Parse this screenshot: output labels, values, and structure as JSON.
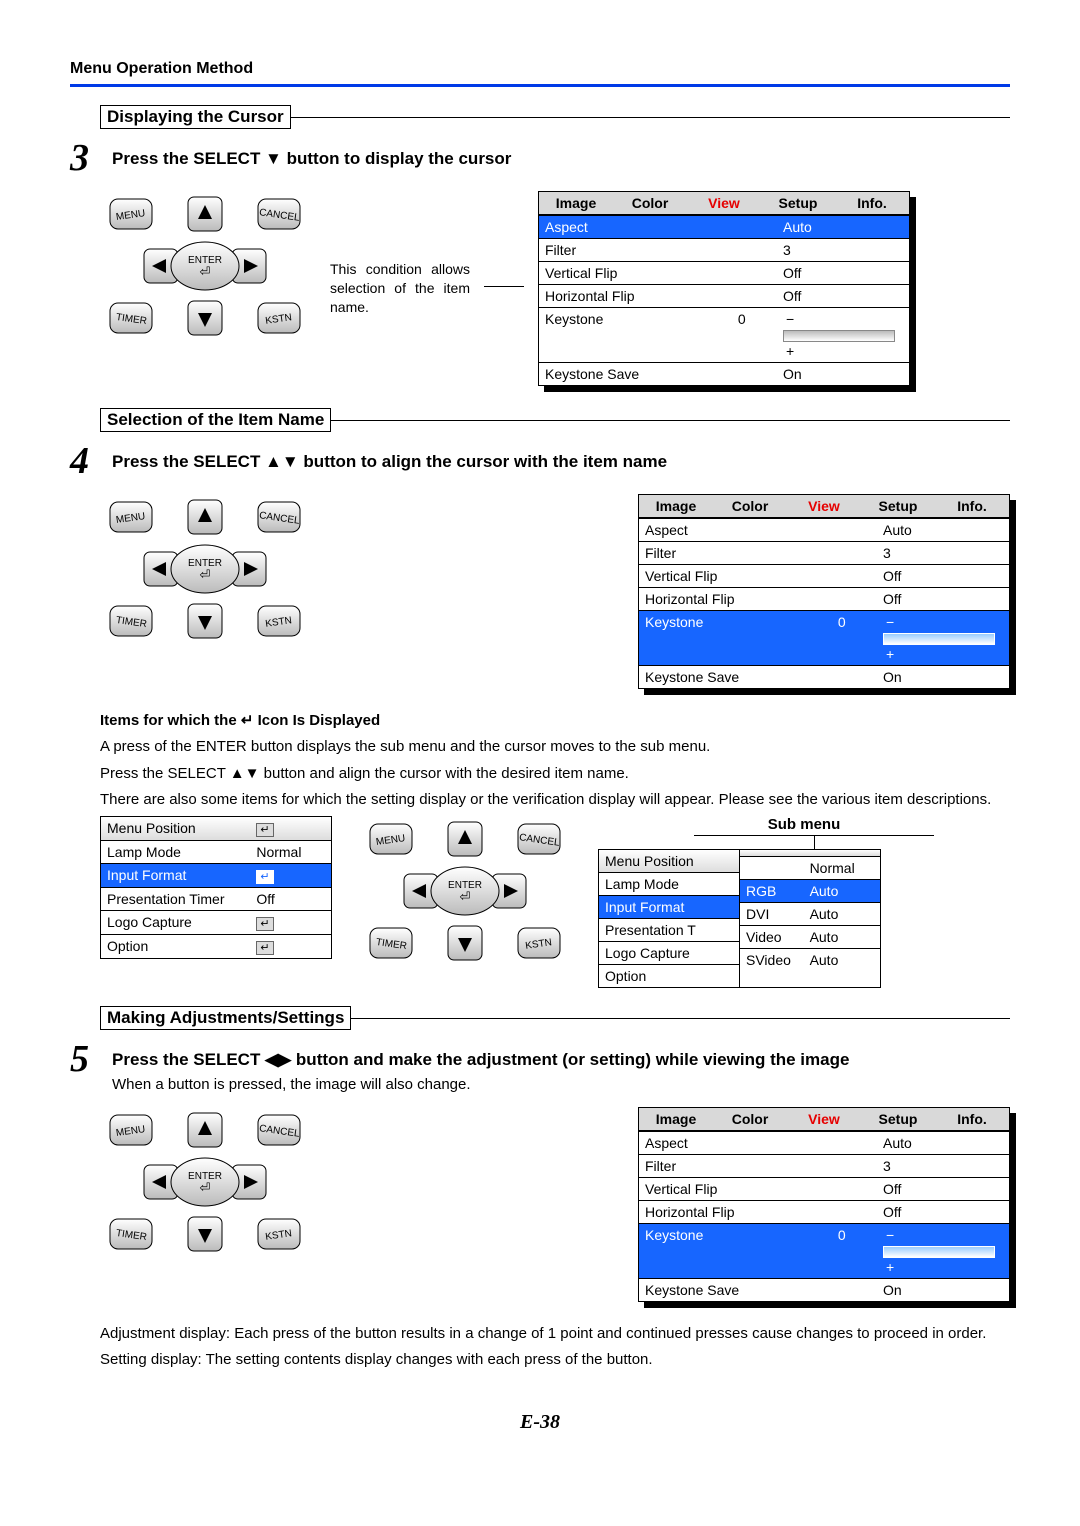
{
  "header": "Menu Operation Method",
  "pagenum": "E-38",
  "sections": {
    "s1_title": "Displaying the Cursor",
    "s2_title": "Selection of the Item Name",
    "s3_title": "Making Adjustments/Settings"
  },
  "steps": {
    "n3": "3",
    "t3": "Press the SELECT ▼ button to display the cursor",
    "n4": "4",
    "t4": "Press the SELECT ▲▼ button to align the cursor with the item name",
    "n5": "5",
    "t5": "Press the SELECT ◀▶ button and make the adjustment (or setting) while viewing the image",
    "t5_sub": "When a button is pressed, the image will also change."
  },
  "note1": "This condition allows selection of the item name.",
  "tabs": {
    "image": "Image",
    "color": "Color",
    "view": "View",
    "setup": "Setup",
    "info": "Info."
  },
  "rows": {
    "aspect": {
      "n": "Aspect",
      "v": "Auto"
    },
    "filter": {
      "n": "Filter",
      "v": "3"
    },
    "vflip": {
      "n": "Vertical Flip",
      "v": "Off"
    },
    "hflip": {
      "n": "Horizontal Flip",
      "v": "Off"
    },
    "key": {
      "n": "Keystone",
      "v": "0"
    },
    "ksave": {
      "n": "Keystone Save",
      "v": "On"
    }
  },
  "icon_note_title": "Items for which the ↵ Icon Is Displayed",
  "icon_note_1": "A press of the ENTER button displays the sub menu and the cursor moves to the sub menu.",
  "icon_note_2": "Press the SELECT ▲▼ button and align the cursor with the desired item name.",
  "icon_note_3": "There are also some items for which the setting display or the verification display will appear. Please see the various item descriptions.",
  "setup_rows": {
    "mpos": {
      "n": "Menu Position",
      "v": ""
    },
    "lamp": {
      "n": "Lamp Mode",
      "v": "Normal"
    },
    "ifmt": {
      "n": "Input Format",
      "v": ""
    },
    "ptimer": {
      "n": "Presentation Timer",
      "v": "Off"
    },
    "logo": {
      "n": "Logo Capture",
      "v": ""
    },
    "opt": {
      "n": "Option",
      "v": ""
    }
  },
  "submenu_label": "Sub menu",
  "sub_rows": {
    "rgb": {
      "a": "RGB",
      "b": "Auto"
    },
    "dvi": {
      "a": "DVI",
      "b": "Auto"
    },
    "video": {
      "a": "Video",
      "b": "Auto"
    },
    "svideo": {
      "a": "SVideo",
      "b": "Auto"
    }
  },
  "setup_rows2": {
    "mpos": {
      "n": "Menu Position",
      "v": ""
    },
    "lamp": {
      "n": "Lamp Mode",
      "v": "Normal"
    },
    "ifmt": {
      "n": "Input Format",
      "v": ""
    },
    "ptimer": {
      "n": "Presentation T",
      "v": ""
    },
    "logo": {
      "n": "Logo Capture",
      "v": ""
    },
    "opt": {
      "n": "Option",
      "v": ""
    }
  },
  "foot1": "Adjustment display: Each press of the button results in a change of 1 point and continued presses cause changes to proceed in order.",
  "foot2": "Setting display: The setting contents display changes with each press of the button.",
  "remote": {
    "menu": "MENU",
    "cancel": "CANCEL",
    "timer": "TIMER",
    "kstn": "KSTN",
    "enter": "ENTER"
  }
}
